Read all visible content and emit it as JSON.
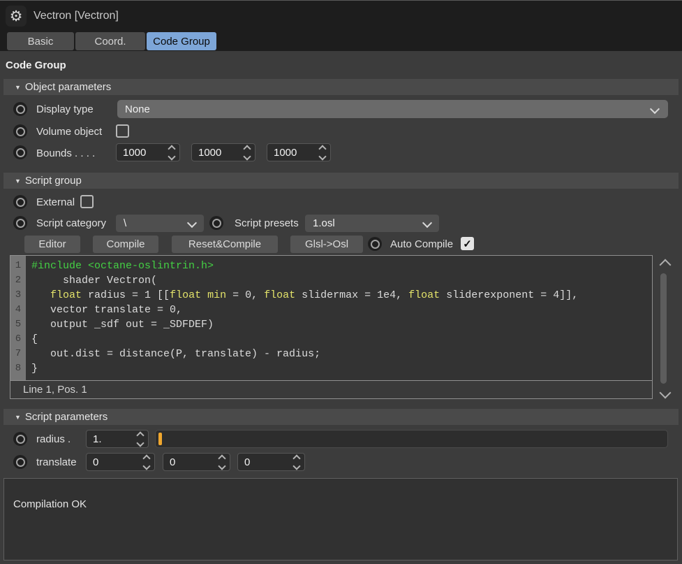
{
  "window": {
    "title": "Vectron [Vectron]"
  },
  "tabs": {
    "basic": "Basic",
    "coord": "Coord.",
    "code_group": "Code Group"
  },
  "heading": "Code Group",
  "object_parameters": {
    "title": "Object parameters",
    "display_type_label": "Display type",
    "display_type_value": "None",
    "volume_object_label": "Volume object",
    "bounds_label": "Bounds . . . .",
    "bounds_values": [
      "1000",
      "1000",
      "1000"
    ]
  },
  "script_group": {
    "title": "Script group",
    "external_label": "External",
    "script_category_label": "Script category",
    "script_category_value": "\\",
    "script_presets_label": "Script presets",
    "script_presets_value": "1.osl",
    "buttons": {
      "editor": "Editor",
      "compile": "Compile",
      "reset_compile": "Reset&Compile",
      "glsl_osl": "Glsl->Osl"
    },
    "auto_compile_label": "Auto Compile"
  },
  "code_editor": {
    "status": "Line 1, Pos. 1",
    "lines": [
      {
        "no": 1,
        "tokens": [
          {
            "c": "green",
            "t": "#include <octane-oslintrin.h>"
          }
        ]
      },
      {
        "no": 2,
        "tokens": [
          {
            "c": "plain",
            "t": "     shader Vectron("
          }
        ]
      },
      {
        "no": 3,
        "tokens": [
          {
            "c": "plain",
            "t": "   "
          },
          {
            "c": "kw",
            "t": "float"
          },
          {
            "c": "plain",
            "t": " radius = 1 [["
          },
          {
            "c": "kw",
            "t": "float"
          },
          {
            "c": "plain",
            "t": " "
          },
          {
            "c": "kw",
            "t": "min"
          },
          {
            "c": "plain",
            "t": " = 0, "
          },
          {
            "c": "kw",
            "t": "float"
          },
          {
            "c": "plain",
            "t": " slidermax = 1e4, "
          },
          {
            "c": "kw",
            "t": "float"
          },
          {
            "c": "plain",
            "t": " sliderexponent = 4]],"
          }
        ]
      },
      {
        "no": 4,
        "tokens": [
          {
            "c": "plain",
            "t": "   vector translate = 0,"
          }
        ]
      },
      {
        "no": 5,
        "tokens": [
          {
            "c": "plain",
            "t": "   output _sdf out = _SDFDEF)"
          }
        ]
      },
      {
        "no": 6,
        "tokens": [
          {
            "c": "plain",
            "t": "{"
          }
        ]
      },
      {
        "no": 7,
        "tokens": [
          {
            "c": "plain",
            "t": "   out.dist = distance(P, translate) - radius;"
          }
        ]
      },
      {
        "no": 8,
        "tokens": [
          {
            "c": "plain",
            "t": "}"
          }
        ]
      }
    ]
  },
  "script_parameters": {
    "title": "Script parameters",
    "radius_label": "radius .",
    "radius_value": "1.",
    "translate_label": "translate",
    "translate_values": [
      "0",
      "0",
      "0"
    ]
  },
  "output": {
    "message": "Compilation OK"
  },
  "colors": {
    "accent_tab": "#7da6d8",
    "slider_handle": "#f0a72e",
    "code_green": "#44d044",
    "code_keyword": "#e3e36a"
  }
}
